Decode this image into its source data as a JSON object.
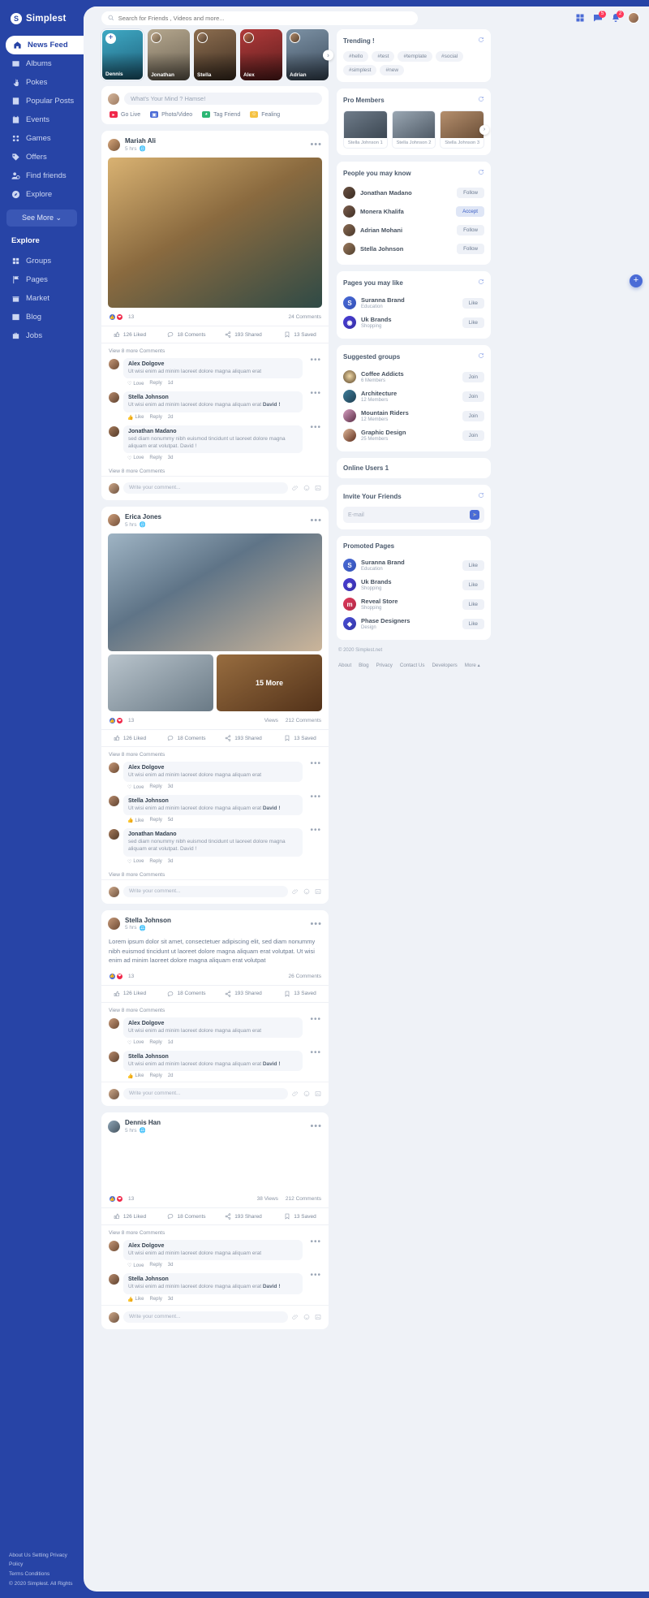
{
  "brand": {
    "name": "Simplest",
    "mark": "S"
  },
  "sidebar": {
    "items": [
      {
        "label": "News Feed",
        "icon": "home-icon",
        "active": true
      },
      {
        "label": "Albums",
        "icon": "albums-icon"
      },
      {
        "label": "Pokes",
        "icon": "poke-icon"
      },
      {
        "label": "Popular Posts",
        "icon": "popular-icon"
      },
      {
        "label": "Events",
        "icon": "calendar-icon"
      },
      {
        "label": "Games",
        "icon": "games-icon"
      },
      {
        "label": "Offers",
        "icon": "tag-icon"
      },
      {
        "label": "Find friends",
        "icon": "find-friends-icon"
      },
      {
        "label": "Explore",
        "icon": "compass-icon"
      }
    ],
    "see_more": "See More",
    "explore_title": "Explore",
    "explore_items": [
      {
        "label": "Groups",
        "icon": "groups-icon"
      },
      {
        "label": "Pages",
        "icon": "pages-icon"
      },
      {
        "label": "Market",
        "icon": "market-icon"
      },
      {
        "label": "Blog",
        "icon": "blog-icon"
      },
      {
        "label": "Jobs",
        "icon": "jobs-icon"
      }
    ],
    "footer_links_1": [
      "About Us",
      "Setting",
      "Privacy Policy"
    ],
    "footer_links_2": [
      "Terms",
      "Conditions"
    ],
    "copyright": "© 2020  Simplest. All Rights"
  },
  "topbar": {
    "search_placeholder": "Search for Friends , Videos and more...",
    "icons": [
      {
        "name": "apps-icon",
        "badge": ""
      },
      {
        "name": "messages-icon",
        "badge": "5"
      },
      {
        "name": "notifications-icon",
        "badge": "2"
      }
    ]
  },
  "stories": [
    {
      "name": "Dennis",
      "add": true,
      "c1": "#3fa9c4",
      "c2": "#1d5f7a"
    },
    {
      "name": "Jonathan",
      "c1": "#b5a78e",
      "c2": "#6b6253"
    },
    {
      "name": "Stella",
      "c1": "#8c6d4f",
      "c2": "#3f2f22"
    },
    {
      "name": "Alex",
      "c1": "#b03a3a",
      "c2": "#5c1d1d"
    },
    {
      "name": "Adrian",
      "c1": "#7d92a5",
      "c2": "#3b4b5c"
    }
  ],
  "composer": {
    "placeholder": "What's Your Mind ? Hamse!",
    "actions": [
      {
        "label": "Go Live",
        "icon": "live-icon",
        "color": "#f0284a"
      },
      {
        "label": "Photo/Video",
        "icon": "photo-icon",
        "color": "#4a6bd6"
      },
      {
        "label": "Tag Friend",
        "icon": "tag-friend-icon",
        "color": "#2bb673"
      },
      {
        "label": "Fealing",
        "icon": "feeling-icon",
        "color": "#f5c242"
      }
    ]
  },
  "posts": [
    {
      "author": "Mariah Ali",
      "time": "5 hrs",
      "reaction_count": "13",
      "meta_right": "24 Comments",
      "stats": [
        {
          "label": "126 Liked",
          "icon": "thumb-up-icon"
        },
        {
          "label": "18 Coments",
          "icon": "comment-icon"
        },
        {
          "label": "193 Shared",
          "icon": "share-icon"
        },
        {
          "label": "13 Saved",
          "icon": "bookmark-icon"
        }
      ],
      "view_more_top": "View 8 more Comments",
      "view_more_bottom": "View 8 more Comments",
      "comment_placeholder": "Write your comment...",
      "comments": [
        {
          "name": "Alex Dolgove",
          "text": "Ut wisi enim ad minim laoreet dolore magna aliquam erat",
          "actions": [
            "Love",
            "Reply",
            "1d"
          ],
          "like_label": "Love"
        },
        {
          "name": "Stella Johnson",
          "text": "Ut wisi enim ad minim laoreet dolore magna aliquam erat ",
          "bold": "David !",
          "actions": [
            "Like",
            "Reply",
            "2d"
          ],
          "like_label": "Like"
        },
        {
          "name": "Jonathan Madano",
          "text": "sed diam nonummy nibh euismod tincidunt ut laoreet dolore magna aliquam erat volutpat. David !",
          "actions": [
            "Love",
            "Reply",
            "3d"
          ],
          "like_label": "Love"
        }
      ]
    },
    {
      "author": "Erica Jones",
      "time": "5 hrs",
      "reaction_count": "13",
      "meta_views": "Views",
      "meta_right": "212 Comments",
      "grid_more": "15 More",
      "stats": [
        {
          "label": "126 Liked",
          "icon": "thumb-up-icon"
        },
        {
          "label": "18 Coments",
          "icon": "comment-icon"
        },
        {
          "label": "193 Shared",
          "icon": "share-icon"
        },
        {
          "label": "13 Saved",
          "icon": "bookmark-icon"
        }
      ],
      "view_more_top": "View 8 more Comments",
      "view_more_bottom": "View 8 more Comments",
      "comment_placeholder": "Write your comment...",
      "comments": [
        {
          "name": "Alex Dolgove",
          "text": "Ut wisi enim ad minim laoreet dolore magna aliquam erat",
          "actions": [
            "Love",
            "Reply",
            "3d"
          ],
          "like_label": "Love"
        },
        {
          "name": "Stella Johnson",
          "text": "Ut wisi enim ad minim laoreet dolore magna aliquam erat ",
          "bold": "David !",
          "actions": [
            "Like",
            "Reply",
            "5d"
          ],
          "like_label": "Like"
        },
        {
          "name": "Jonathan Madano",
          "text": "sed diam nonummy nibh euismod tincidunt ut laoreet dolore magna aliquam erat volutpat. David !",
          "actions": [
            "Love",
            "Reply",
            "3d"
          ],
          "like_label": "Love"
        }
      ]
    },
    {
      "author": "Stella Johnson",
      "time": "5 hrs",
      "body": "Lorem ipsum dolor sit amet, consectetuer adipiscing elit, sed diam nonummy nibh euismod tincidunt ut laoreet dolore magna aliquam erat volutpat. Ut wisi enim ad minim laoreet dolore magna aliquam erat volutpat",
      "reaction_count": "13",
      "meta_right": "26 Comments",
      "stats": [
        {
          "label": "126 Liked",
          "icon": "thumb-up-icon"
        },
        {
          "label": "18 Coments",
          "icon": "comment-icon"
        },
        {
          "label": "193 Shared",
          "icon": "share-icon"
        },
        {
          "label": "13 Saved",
          "icon": "bookmark-icon"
        }
      ],
      "view_more_top": "View 8 more Comments",
      "comment_placeholder": "Write your comment...",
      "comments": [
        {
          "name": "Alex Dolgove",
          "text": "Ut wisi enim ad minim laoreet dolore magna aliquam erat",
          "actions": [
            "Love",
            "Reply",
            "1d"
          ],
          "like_label": "Love"
        },
        {
          "name": "Stella Johnson",
          "text": "Ut wisi enim ad minim laoreet dolore magna aliquam erat ",
          "bold": "David !",
          "actions": [
            "Like",
            "Reply",
            "2d"
          ],
          "like_label": "Like"
        }
      ]
    },
    {
      "author": "Dennis Han",
      "time": "5 hrs",
      "reaction_count": "13",
      "meta_views": "38 Views",
      "meta_right": "212 Comments",
      "stats": [
        {
          "label": "126 Liked",
          "icon": "thumb-up-icon"
        },
        {
          "label": "18 Coments",
          "icon": "comment-icon"
        },
        {
          "label": "193 Shared",
          "icon": "share-icon"
        },
        {
          "label": "13 Saved",
          "icon": "bookmark-icon"
        }
      ],
      "view_more_top": "View 8 more Comments",
      "comment_placeholder": "Write your comment...",
      "comments": [
        {
          "name": "Alex Dolgove",
          "text": "Ut wisi enim ad minim laoreet dolore magna aliquam erat",
          "actions": [
            "Love",
            "Reply",
            "3d"
          ],
          "like_label": "Love"
        },
        {
          "name": "Stella Johnson",
          "text": "Ut wisi enim ad minim laoreet dolore magna aliquam erat ",
          "bold": "David !",
          "actions": [
            "Like",
            "Reply",
            "3d"
          ],
          "like_label": "Like"
        }
      ]
    }
  ],
  "right": {
    "trending": {
      "title": "Trending !",
      "tags": [
        "#hello",
        "#test",
        "#template",
        "#social",
        "#simplest",
        "#new"
      ]
    },
    "pro_members": {
      "title": "Pro Members",
      "members": [
        {
          "name": "Stella Johnson 1",
          "c1": "#6f7c8a",
          "c2": "#3c4752"
        },
        {
          "name": "Stella Johnson 2",
          "c1": "#9aa7b3",
          "c2": "#4f5a66"
        },
        {
          "name": "Stella Johnson 3",
          "c1": "#b58f6d",
          "c2": "#6b4f38"
        }
      ]
    },
    "people": {
      "title": "People you may know",
      "items": [
        {
          "name": "Jonathan Madano",
          "action": "Follow",
          "accent": false,
          "c1": "#6b5242",
          "c2": "#3a2c23"
        },
        {
          "name": "Monera Khalifa",
          "action": "Accept",
          "accent": true,
          "c1": "#7d5f4d",
          "c2": "#3f2f26"
        },
        {
          "name": "Adrian Mohani",
          "action": "Follow",
          "accent": false,
          "c1": "#8a6b52",
          "c2": "#4a392c"
        },
        {
          "name": "Stella Johnson",
          "action": "Follow",
          "accent": false,
          "c1": "#9b7a5e",
          "c2": "#52412f"
        }
      ]
    },
    "pages": {
      "title": "Pages you may like",
      "items": [
        {
          "name": "Suranna Brand",
          "sub": "Education",
          "action": "Like",
          "mark": "S",
          "c1": "#4a6bd6",
          "c2": "#3451b8"
        },
        {
          "name": "Uk Brands",
          "sub": "Shopping",
          "action": "Like",
          "mark": "◉",
          "c1": "#4a3fd6",
          "c2": "#3730a8"
        }
      ]
    },
    "groups": {
      "title": "Suggested groups",
      "items": [
        {
          "name": "Coffee Addicts",
          "sub": "6 Members",
          "action": "Join",
          "c1": "#d9b77a",
          "c2": "#5a4326"
        },
        {
          "name": "Architecture",
          "sub": "12 Members",
          "action": "Join",
          "c1": "#3f7f9c",
          "c2": "#1f3f52"
        },
        {
          "name": "Mountain Riders",
          "sub": "12 Members",
          "action": "Join",
          "c1": "#b85c8a",
          "c2": "#5a2c44"
        },
        {
          "name": "Graphic Design",
          "sub": "25 Members",
          "action": "Join",
          "c1": "#c0603c",
          "c2": "#5e2e1d"
        }
      ]
    },
    "online_users": {
      "title": "Online Users 1"
    },
    "invite": {
      "title": "Invite Your Friends",
      "placeholder": "E-mail",
      "send": "➤"
    },
    "promoted": {
      "title": "Promoted Pages",
      "items": [
        {
          "name": "Suranna Brand",
          "sub": "Education",
          "action": "Like",
          "mark": "S",
          "c1": "#4a6bd6",
          "c2": "#3451b8"
        },
        {
          "name": "Uk Brands",
          "sub": "Shopping",
          "action": "Like",
          "mark": "◉",
          "c1": "#4a3fd6",
          "c2": "#3730a8"
        },
        {
          "name": "Reveal Store",
          "sub": "Shopping",
          "action": "Like",
          "mark": "m",
          "c1": "#e03a5c",
          "c2": "#b02845"
        },
        {
          "name": "Phase Designers",
          "sub": "Design",
          "action": "Like",
          "mark": "◆",
          "c1": "#4a4fd6",
          "c2": "#3436a8"
        }
      ]
    },
    "copyright": "© 2020 Simplest.net",
    "links": [
      "About",
      "Blog",
      "Privacy",
      "Contact Us",
      "Developers",
      "More ▴"
    ]
  },
  "fab": "+"
}
